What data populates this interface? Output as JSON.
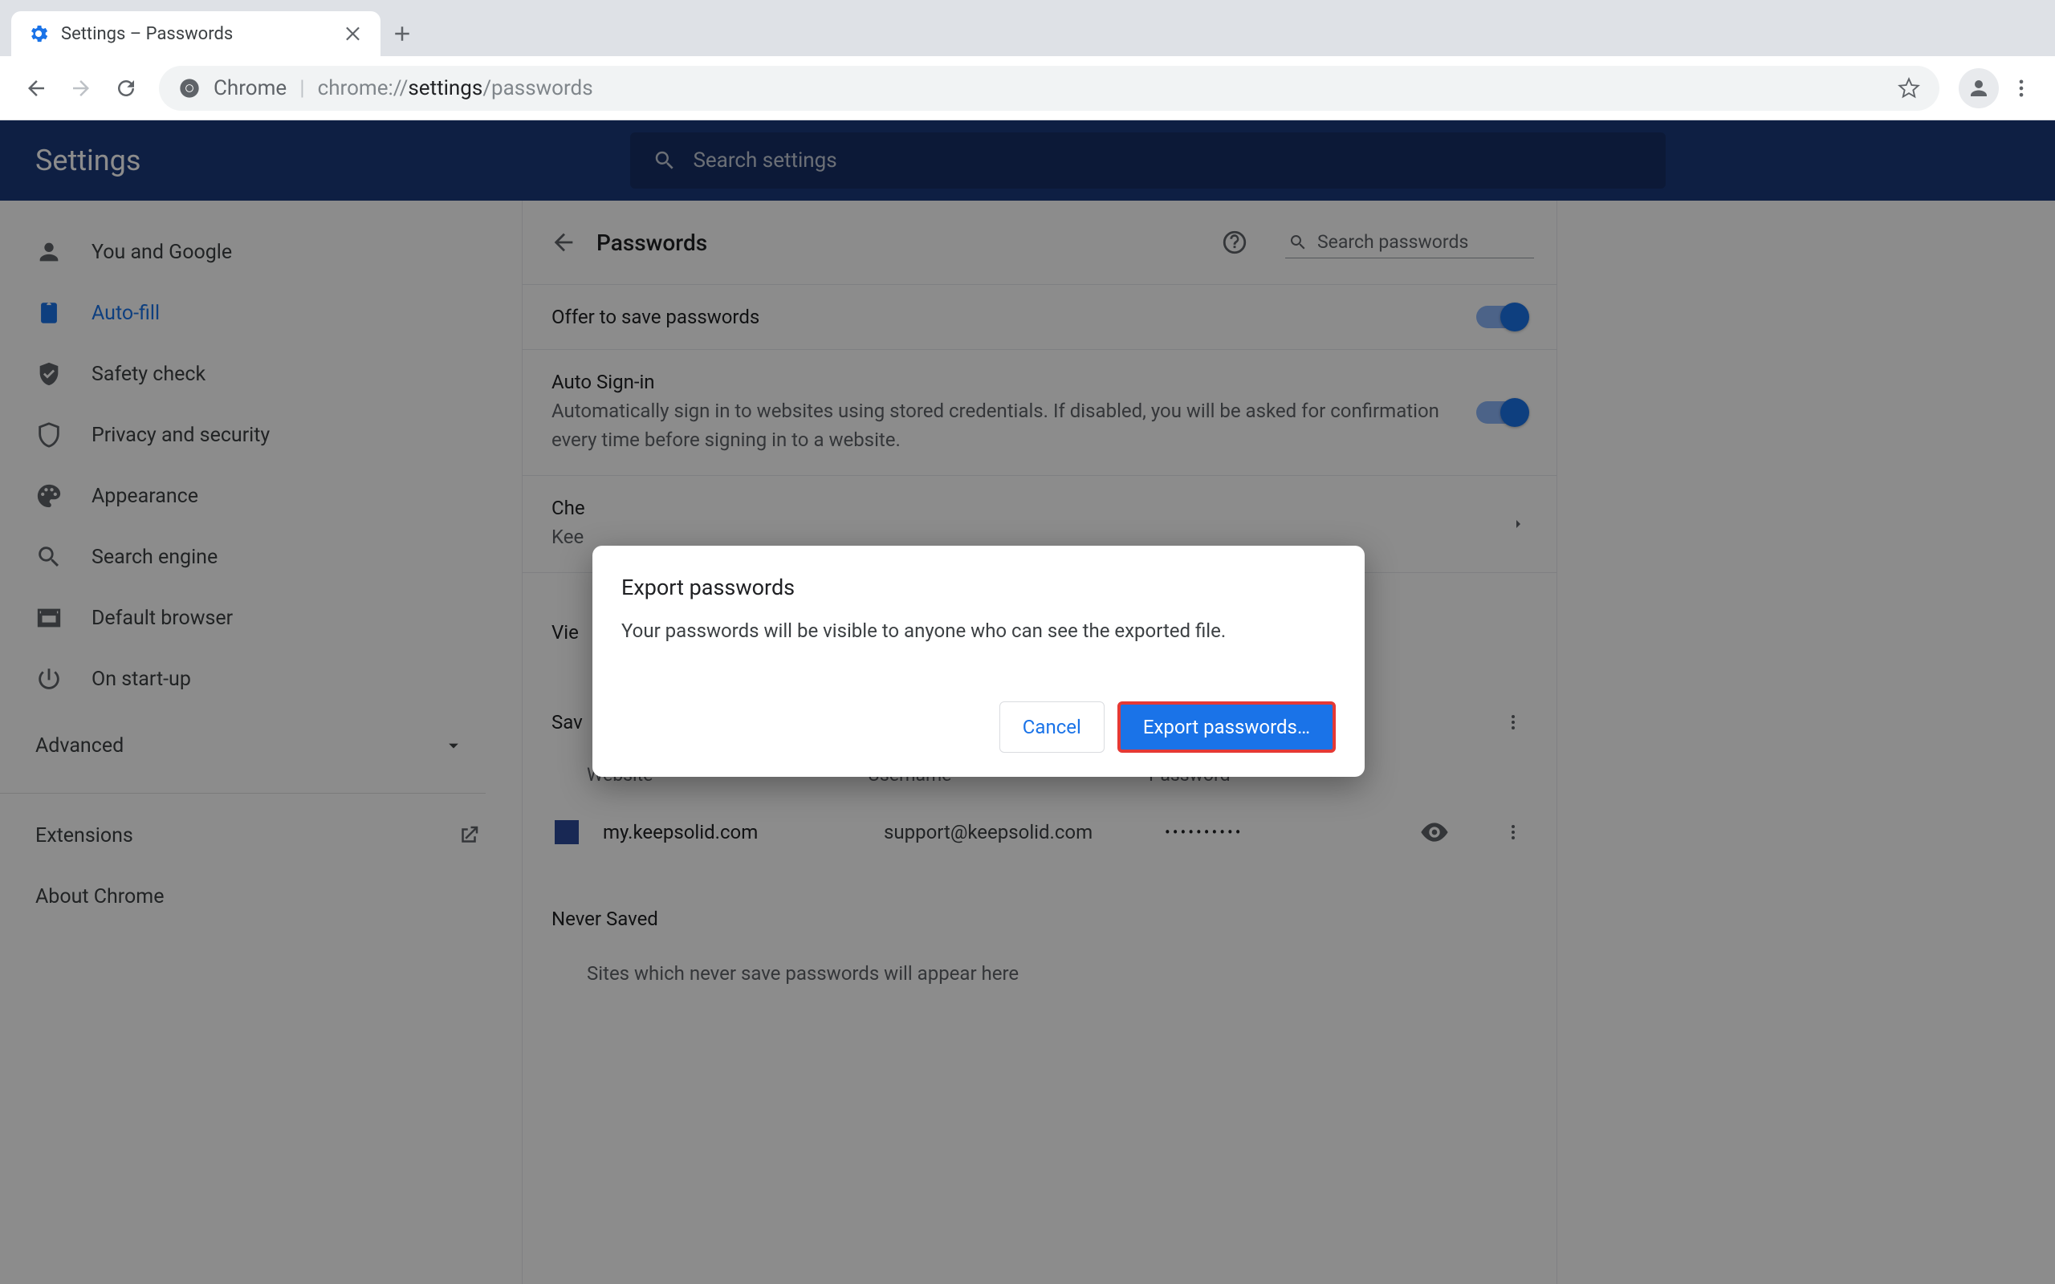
{
  "tab": {
    "title": "Settings – Passwords"
  },
  "omnibox": {
    "chip": "Chrome",
    "url_prefix": "chrome://",
    "url_bold": "settings",
    "url_suffix": "/passwords"
  },
  "header": {
    "app_title": "Settings",
    "search_placeholder": "Search settings"
  },
  "sidebar": {
    "items": [
      {
        "label": "You and Google"
      },
      {
        "label": "Auto-fill"
      },
      {
        "label": "Safety check"
      },
      {
        "label": "Privacy and security"
      },
      {
        "label": "Appearance"
      },
      {
        "label": "Search engine"
      },
      {
        "label": "Default browser"
      },
      {
        "label": "On start-up"
      }
    ],
    "advanced": "Advanced",
    "extensions": "Extensions",
    "about": "About Chrome"
  },
  "page": {
    "title": "Passwords",
    "search_pw_placeholder": "Search passwords",
    "offer_save": "Offer to save passwords",
    "auto_signin_title": "Auto Sign-in",
    "auto_signin_sub": "Automatically sign in to websites using stored credentials. If disabled, you will be asked for confirmation every time before signing in to a website.",
    "check_title_frag": "Che",
    "check_sub_frag": "Kee",
    "view_frag": "Vie",
    "saved_label_frag": "Sav",
    "columns": {
      "website": "Website",
      "username": "Username",
      "password": "Password"
    },
    "row": {
      "site": "my.keepsolid.com",
      "user": "support@keepsolid.com",
      "mask": "••••••••••"
    },
    "never_label": "Never Saved",
    "never_empty": "Sites which never save passwords will appear here"
  },
  "dialog": {
    "title": "Export passwords",
    "body": "Your passwords will be visible to anyone who can see the exported file.",
    "cancel": "Cancel",
    "confirm": "Export passwords…"
  }
}
